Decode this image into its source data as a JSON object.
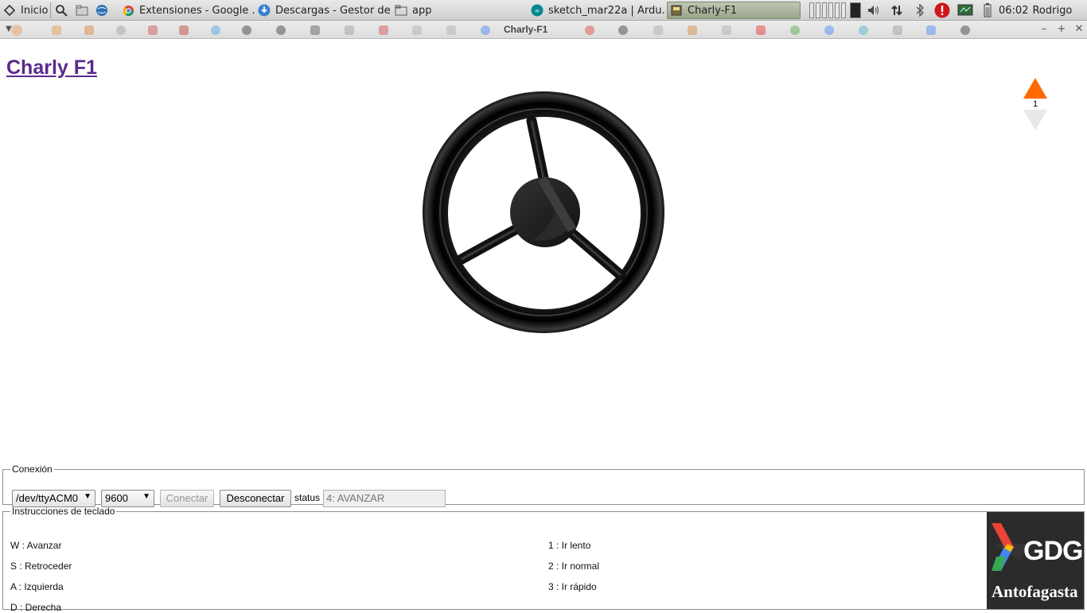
{
  "taskbar": {
    "start_label": "Inicio",
    "tasks": [
      {
        "label": "Extensiones - Google ..."
      },
      {
        "label": "Descargas - Gestor de..."
      },
      {
        "label": "app"
      },
      {
        "label": "sketch_mar22a | Ardu..."
      },
      {
        "label": "Charly-F1"
      }
    ],
    "clock": "06:02",
    "user": "Rodrigo"
  },
  "browser": {
    "window_title": "Charly-F1"
  },
  "page": {
    "title": "Charly F1",
    "speed_level": "1"
  },
  "conexion": {
    "legend": "Conexión",
    "port": "/dev/ttyACM0",
    "baud": "9600",
    "connect_label": "Conectar",
    "disconnect_label": "Desconectar",
    "status_label": "status",
    "status_value": "4: AVANZAR"
  },
  "instrucciones": {
    "legend": "Instrucciones de teclado",
    "left": [
      "W : Avanzar",
      "S : Retroceder",
      "A : Izquierda",
      "D : Derecha"
    ],
    "right": [
      "1 : Ir lento",
      "2 : Ir normal",
      "3 : Ir rápido"
    ]
  },
  "logo": {
    "gdg": "GDG",
    "city": "Antofagasta"
  }
}
